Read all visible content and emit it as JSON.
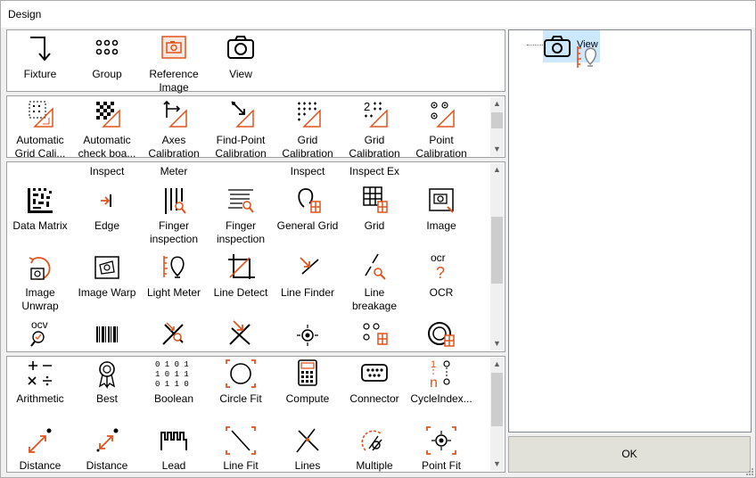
{
  "window": {
    "title": "Design"
  },
  "panel1": {
    "items": [
      {
        "name": "fixture",
        "label": "Fixture"
      },
      {
        "name": "group",
        "label": "Group"
      },
      {
        "name": "reference-image",
        "label": "Reference Image"
      },
      {
        "name": "view",
        "label": "View"
      }
    ]
  },
  "panel2": {
    "items": [
      {
        "name": "automatic-grid-calibration",
        "label": "Automatic Grid Cali..."
      },
      {
        "name": "automatic-checkerboard",
        "label": "Automatic check boa..."
      },
      {
        "name": "axes-calibration",
        "label": "Axes Calibration"
      },
      {
        "name": "find-point-calibration",
        "label": "Find-Point Calibration"
      },
      {
        "name": "grid-calibration",
        "label": "Grid Calibration"
      },
      {
        "name": "grid-calibration-2",
        "label": "Grid Calibration"
      },
      {
        "name": "point-calibration",
        "label": "Point Calibration"
      }
    ]
  },
  "panel3": {
    "top_fragments": [
      "",
      "Inspect",
      "Meter",
      "",
      "Inspect",
      "Inspect Ex",
      ""
    ],
    "row1": [
      {
        "name": "data-matrix",
        "label": "Data Matrix"
      },
      {
        "name": "edge",
        "label": "Edge"
      },
      {
        "name": "finger-inspection",
        "label": "Finger inspection"
      },
      {
        "name": "finger-inspection-2",
        "label": "Finger inspection"
      },
      {
        "name": "general-grid",
        "label": "General Grid"
      },
      {
        "name": "grid",
        "label": "Grid"
      },
      {
        "name": "image",
        "label": "Image"
      }
    ],
    "row2": [
      {
        "name": "image-unwrap",
        "label": "Image Unwrap"
      },
      {
        "name": "image-warp",
        "label": "Image Warp"
      },
      {
        "name": "light-meter",
        "label": "Light Meter"
      },
      {
        "name": "line-detect",
        "label": "Line Detect"
      },
      {
        "name": "line-finder",
        "label": "Line Finder"
      },
      {
        "name": "line-breakage",
        "label": "Line breakage"
      },
      {
        "name": "ocr",
        "label": "OCR"
      }
    ]
  },
  "panel4": {
    "row1": [
      {
        "name": "arithmetic",
        "label": "Arithmetic"
      },
      {
        "name": "best",
        "label": "Best"
      },
      {
        "name": "boolean",
        "label": "Boolean"
      },
      {
        "name": "circle-fit",
        "label": "Circle Fit"
      },
      {
        "name": "compute",
        "label": "Compute"
      },
      {
        "name": "connector",
        "label": "Connector"
      },
      {
        "name": "cycle-index",
        "label": "CycleIndex..."
      }
    ],
    "row2": [
      {
        "name": "distance",
        "label": "Distance"
      },
      {
        "name": "distance-2",
        "label": "Distance"
      },
      {
        "name": "lead",
        "label": "Lead"
      },
      {
        "name": "line-fit",
        "label": "Line Fit"
      },
      {
        "name": "lines",
        "label": "Lines"
      },
      {
        "name": "multiple",
        "label": "Multiple"
      },
      {
        "name": "point-fit",
        "label": "Point Fit"
      }
    ]
  },
  "tree": {
    "node_label": "View"
  },
  "ok_button": {
    "label": "OK"
  },
  "colors": {
    "accent": "#e0531d",
    "tree_selection": "#cce8ff"
  }
}
